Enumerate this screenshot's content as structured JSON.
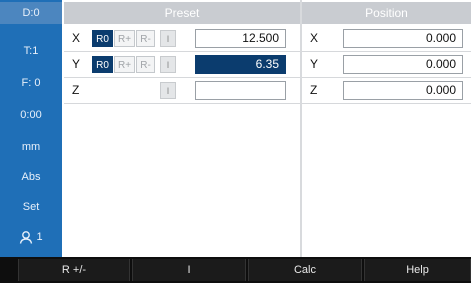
{
  "sidebar": {
    "items": [
      {
        "label": "D:0"
      },
      {
        "label": "T:1"
      },
      {
        "label": "F:  0"
      },
      {
        "label": "0:00"
      },
      {
        "label": "mm"
      },
      {
        "label": "Abs"
      },
      {
        "label": "Set"
      },
      {
        "label": "1",
        "icon": "user-icon"
      }
    ]
  },
  "headers": {
    "preset": "Preset",
    "position": "Position"
  },
  "preset": {
    "rows": [
      {
        "axis": "X",
        "r0": "R0",
        "rplus": "R+",
        "rminus": "R-",
        "i": "I",
        "value": "12.500",
        "r0_active": true,
        "selected": false
      },
      {
        "axis": "Y",
        "r0": "R0",
        "rplus": "R+",
        "rminus": "R-",
        "i": "I",
        "value": "6.35",
        "r0_active": true,
        "selected": true
      },
      {
        "axis": "Z",
        "i": "I",
        "value": ""
      }
    ]
  },
  "position": {
    "rows": [
      {
        "axis": "X",
        "value": "0.000"
      },
      {
        "axis": "Y",
        "value": "0.000"
      },
      {
        "axis": "Z",
        "value": "0.000"
      }
    ]
  },
  "softkeys": [
    "R +/-",
    "I",
    "Calc",
    "Help"
  ],
  "colors": {
    "sidebar": "#1f6fb7",
    "selected": "#0b3c6e",
    "header": "#c9ccd1",
    "softkey_bar": "#0e0e0e"
  }
}
